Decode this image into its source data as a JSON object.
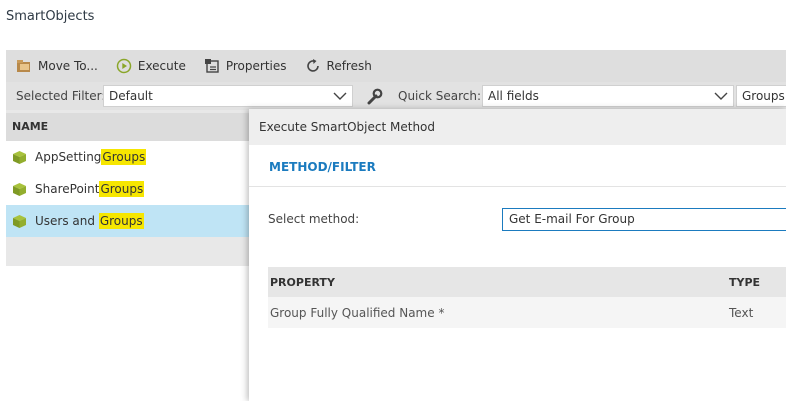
{
  "page": {
    "title": "SmartObjects"
  },
  "toolbar": {
    "move_to": "Move To...",
    "execute": "Execute",
    "properties": "Properties",
    "refresh": "Refresh"
  },
  "filter": {
    "selected_filter_label": "Selected Filter:",
    "selected_filter_value": "Default",
    "quick_search_label": "Quick Search:",
    "quick_search_field": "All fields",
    "search_text": "Groups"
  },
  "grid": {
    "header": "NAME",
    "rows": [
      {
        "prefix": "AppSetting",
        "match": "Groups",
        "selected": false
      },
      {
        "prefix": "SharePoint",
        "match": "Groups",
        "selected": false
      },
      {
        "prefix": "Users and ",
        "match": "Groups",
        "selected": true
      }
    ]
  },
  "dialog": {
    "title": "Execute SmartObject Method",
    "tab": "METHOD/FILTER",
    "method_label": "Select method:",
    "method_value": "Get E-mail For Group",
    "table": {
      "headers": [
        "PROPERTY",
        "TYPE"
      ],
      "rows": [
        {
          "property": "Group Fully Qualified Name *",
          "type": "Text"
        }
      ]
    }
  },
  "colors": {
    "accent": "#1b7bbf",
    "selected_row": "#bfe4f5",
    "highlight": "#f6e600",
    "icon_green": "#8aa629"
  },
  "icons": {
    "move_to": "folder-move-icon",
    "execute": "play-circle-icon",
    "properties": "properties-icon",
    "refresh": "refresh-icon",
    "quick_search": "wrench-icon",
    "row": "smartobject-cube-icon"
  }
}
